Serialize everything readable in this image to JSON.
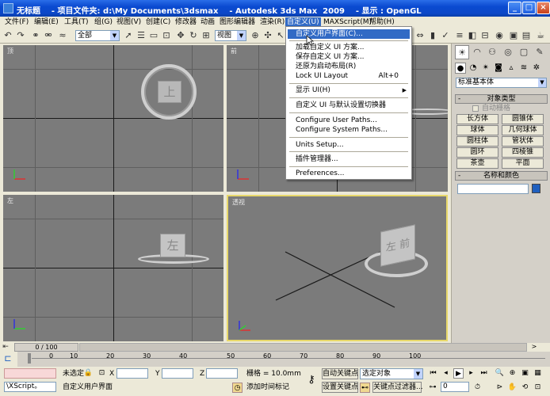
{
  "window": {
    "title": "无标题    - 项目文件夹: d:\\My Documents\\3dsmax    - Autodesk 3ds Max  2009    - 显示 : OpenGL",
    "minimize": "_",
    "maximize": "□",
    "close": "×"
  },
  "menubar": {
    "items": [
      "文件(F)",
      "编辑(E)",
      "工具(T)",
      "组(G)",
      "视图(V)",
      "创建(C)",
      "修改器",
      "动画",
      "图形编辑器",
      "渲染(R)",
      "自定义(U)",
      "MAXScript(M)",
      "帮助(H)"
    ]
  },
  "toolbar": {
    "selection_filter": "全部",
    "reference_coord": "视图"
  },
  "customize_menu": {
    "items": [
      {
        "label": "自定义用户界面(C)...",
        "shortcut": "",
        "highlighted": true
      },
      {
        "label": "加载自定义 UI 方案...",
        "shortcut": ""
      },
      {
        "label": "保存自定义 UI 方案...",
        "shortcut": ""
      },
      {
        "label": "还原为启动布局(R)",
        "shortcut": ""
      },
      {
        "label": "Lock UI Layout",
        "shortcut": "Alt+0"
      },
      {
        "label": "显示 UI(H)",
        "shortcut": "",
        "submenu": "▶"
      },
      {
        "label": "自定义 UI 与默认设置切换器",
        "shortcut": ""
      },
      {
        "label": "Configure User Paths...",
        "shortcut": ""
      },
      {
        "label": "Configure System Paths...",
        "shortcut": ""
      },
      {
        "label": "Units Setup...",
        "shortcut": ""
      },
      {
        "label": "插件管理器...",
        "shortcut": ""
      },
      {
        "label": "Preferences...",
        "shortcut": ""
      }
    ]
  },
  "viewports": {
    "top_label": "顶",
    "front_label": "前",
    "left_label": "左",
    "perspective_label": "透视",
    "top_cube_text": "上",
    "left_cube_text": "左",
    "persp_cube_text_1": "左",
    "persp_cube_text_2": "前"
  },
  "command_panel": {
    "category_dropdown": "标准基本体",
    "object_type_header": "对象类型",
    "autogrid_label": "自动栅格",
    "object_buttons": [
      "长方体",
      "圆锥体",
      "球体",
      "几何球体",
      "圆柱体",
      "管状体",
      "圆环",
      "四棱锥",
      "茶壶",
      "平面"
    ],
    "name_color_header": "名称和颜色",
    "rollout_sign": "-",
    "color_swatch": "#1f5fbf"
  },
  "timeline": {
    "frame_counter": "0 / 100",
    "ticks": [
      "0",
      "10",
      "20",
      "30",
      "40",
      "50",
      "60",
      "70",
      "80",
      "90",
      "100"
    ]
  },
  "statusbar": {
    "maxscript_listener": "\\XScript。",
    "selection_status": "未选定",
    "prompt": "自定义用户界面",
    "x_label": "X",
    "y_label": "Y",
    "z_label": "Z",
    "grid_label": "栅格 = 10.0mm",
    "add_time_tag": "添加时间标记",
    "auto_key": "自动关键点",
    "set_key": "设置关键点",
    "selected_object": "选定对象",
    "key_filters": "关键点过滤器...",
    "current_frame": "0"
  }
}
